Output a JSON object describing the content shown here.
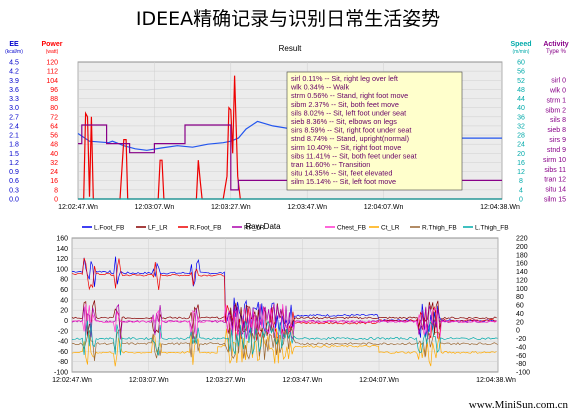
{
  "page": {
    "title": "IDEEA精确记录与识别日常生活姿势",
    "footer": "www.MiniSun.com.cn"
  },
  "chart_data": [
    {
      "type": "line",
      "title": "Result",
      "left_axes": [
        {
          "name": "EE",
          "unit": "(kcal/m)",
          "color": "#0000cc",
          "ticks": [
            "4.5",
            "4.2",
            "3.9",
            "3.6",
            "3.3",
            "3.0",
            "2.7",
            "2.4",
            "2.1",
            "1.8",
            "1.5",
            "1.2",
            "0.9",
            "0.6",
            "0.3",
            "0.0"
          ]
        },
        {
          "name": "Power",
          "unit": "(watt)",
          "color": "#ff0000",
          "ticks": [
            "120",
            "112",
            "104",
            "96",
            "88",
            "80",
            "72",
            "64",
            "56",
            "48",
            "40",
            "32",
            "24",
            "16",
            "8",
            "0"
          ]
        }
      ],
      "right_axes": [
        {
          "name": "Speed",
          "unit": "(m/min)",
          "color": "#00aaaa",
          "ticks": [
            "60",
            "56",
            "52",
            "48",
            "44",
            "40",
            "36",
            "32",
            "28",
            "24",
            "20",
            "16",
            "12",
            "8",
            "4",
            "0"
          ]
        },
        {
          "name": "Activity",
          "unit": "Type %",
          "color": "#880088",
          "ticks": [
            "sirl 0",
            "wlk 0",
            "strm 1",
            "sibm 2",
            "sils 8",
            "sieb 8",
            "sirs 9",
            "stnd 9",
            "sirm 10",
            "sibs 11",
            "tran 12",
            "situ 14",
            "silm 15"
          ]
        }
      ],
      "x_ticks": [
        "12:02:47.Wn",
        "12:03:07.Wn",
        "12:03:27.Wn",
        "12:03:47.Wn",
        "12:04:07.Wn",
        "12:04:38.Wn"
      ],
      "x_seconds": [
        0,
        20,
        40,
        60,
        80,
        111
      ],
      "legend_box": [
        "sirl 0.11% -- Sit, right leg over left",
        "wlk 0.34% -- Walk",
        "strm 0.56% -- Stand, right foot move",
        "sibm 2.37% -- Sit, both feet move",
        "sils 8.02% -- Sit, left foot under seat",
        "sieb 8.36% -- Sit, elbows on legs",
        "sirs 8.59% -- Sit, right foot under seat",
        "stnd 8.74% -- Stand, upright(normal)",
        "sirm 10.40% -- Sit, right foot move",
        "sibs 11.41% -- Sit, both feet under seat",
        "tran 11.60% -- Transition",
        "situ 14.35% -- Sit, feet elevated",
        "silm 15.14% -- Sit, left foot move"
      ],
      "series": [
        {
          "name": "EE",
          "color": "#2255ee",
          "axis": "EE",
          "points": [
            [
              0,
              2.15
            ],
            [
              3,
              1.9
            ],
            [
              8,
              1.85
            ],
            [
              9,
              1.9
            ],
            [
              12,
              1.75
            ],
            [
              15,
              1.65
            ],
            [
              18,
              1.6
            ],
            [
              22,
              1.68
            ],
            [
              26,
              1.75
            ],
            [
              30,
              1.7
            ],
            [
              34,
              1.8
            ],
            [
              38,
              1.85
            ],
            [
              40,
              1.9
            ],
            [
              42,
              2.0
            ],
            [
              44,
              2.3
            ],
            [
              47,
              2.55
            ],
            [
              51,
              2.4
            ],
            [
              56,
              2.3
            ],
            [
              62,
              2.2
            ],
            [
              68,
              2.12
            ],
            [
              76,
              2.05
            ],
            [
              86,
              2.0
            ],
            [
              100,
              2.0
            ],
            [
              111,
              2.0
            ]
          ]
        },
        {
          "name": "Power",
          "color": "#ee0000",
          "axis": "Power",
          "points": [
            [
              0,
              0
            ],
            [
              1.5,
              0
            ],
            [
              2,
              75
            ],
            [
              2.5,
              72
            ],
            [
              3,
              2
            ],
            [
              3.5,
              72
            ],
            [
              4,
              0
            ],
            [
              11,
              0
            ],
            [
              12,
              52
            ],
            [
              12.6,
              52
            ],
            [
              13,
              0
            ],
            [
              21,
              0
            ],
            [
              21.5,
              34
            ],
            [
              22,
              34
            ],
            [
              22.5,
              0
            ],
            [
              31,
              0
            ],
            [
              31.5,
              34
            ],
            [
              32,
              16
            ],
            [
              32.5,
              0
            ],
            [
              38,
              0
            ],
            [
              39,
              20
            ],
            [
              39.5,
              80
            ],
            [
              40,
              78
            ],
            [
              40.5,
              40
            ],
            [
              41,
              108
            ],
            [
              41.8,
              20
            ],
            [
              42.5,
              0
            ],
            [
              111,
              0
            ]
          ]
        },
        {
          "name": "Activity type",
          "color": "#880088",
          "axis": "Activity",
          "points": [
            [
              0,
              1.82
            ],
            [
              1,
              1.82
            ],
            [
              1,
              2.43
            ],
            [
              7.5,
              2.43
            ],
            [
              7.5,
              1.82
            ],
            [
              13.5,
              1.82
            ],
            [
              13.5,
              1.52
            ],
            [
              20,
              1.52
            ],
            [
              20,
              1.82
            ],
            [
              28,
              1.82
            ],
            [
              28,
              2.43
            ],
            [
              40,
              2.43
            ],
            [
              40,
              0.3
            ],
            [
              42,
              0.3
            ],
            [
              42,
              0.61
            ],
            [
              111,
              0.61
            ]
          ]
        },
        {
          "name": "Speed",
          "color": "#00aaaa",
          "axis": "Speed",
          "points": [
            [
              0,
              0
            ],
            [
              111,
              0
            ]
          ]
        }
      ]
    },
    {
      "type": "line",
      "title": "Raw Data",
      "legend": [
        {
          "name": "L.Foot_FB",
          "color": "#0000ee"
        },
        {
          "name": "LF_LR",
          "color": "#880000"
        },
        {
          "name": "R.Foot_FB",
          "color": "#ee0000"
        },
        {
          "name": "RF_LR",
          "color": "#aa00aa"
        },
        {
          "name": "Chest_FB",
          "color": "#ff33cc"
        },
        {
          "name": "Ct_LR",
          "color": "#ffaa00"
        },
        {
          "name": "R.Thigh_FB",
          "color": "#996633"
        },
        {
          "name": "L.Thigh_FB",
          "color": "#00aaaa"
        }
      ],
      "y_ticks_left": [
        "160",
        "140",
        "120",
        "100",
        "80",
        "60",
        "40",
        "20",
        "0",
        "-20",
        "-40",
        "-60",
        "-80",
        "-100"
      ],
      "y_ticks_right": [
        "220",
        "200",
        "180",
        "160",
        "140",
        "120",
        "100",
        "80",
        "60",
        "40",
        "20",
        "0",
        "-20",
        "-40",
        "-60",
        "-80",
        "-100"
      ],
      "x_ticks": [
        "12:02:47.Wn",
        "12:03:07.Wn",
        "12:03:27.Wn",
        "12:03:47.Wn",
        "12:04:07.Wn",
        "12:04:38.Wn"
      ],
      "x_seconds": [
        0,
        20,
        40,
        60,
        80,
        111
      ],
      "ylim_left": [
        -100,
        160
      ],
      "series_levels": [
        {
          "name": "L.Foot_FB",
          "segments": [
            [
              0,
              10,
              95
            ],
            [
              10,
              40,
              92
            ],
            [
              40,
              80,
              10
            ],
            [
              80,
              111,
              0
            ]
          ]
        },
        {
          "name": "R.Foot_FB",
          "segments": [
            [
              0,
              10,
              90
            ],
            [
              10,
              40,
              88
            ],
            [
              40,
              80,
              -5
            ],
            [
              80,
              111,
              0
            ]
          ]
        },
        {
          "name": "LF_LR",
          "segments": [
            [
              0,
              40,
              5
            ],
            [
              40,
              111,
              5
            ]
          ]
        },
        {
          "name": "RF_LR",
          "segments": [
            [
              0,
              40,
              -2
            ],
            [
              40,
              111,
              -2
            ]
          ]
        },
        {
          "name": "Chest_FB",
          "segments": [
            [
              0,
              111,
              -2
            ]
          ]
        },
        {
          "name": "Ct_LR",
          "segments": [
            [
              0,
              38,
              -62
            ],
            [
              38,
              80,
              -50
            ],
            [
              80,
              111,
              -62
            ]
          ]
        },
        {
          "name": "R.Thigh_FB",
          "segments": [
            [
              0,
              38,
              -45
            ],
            [
              38,
              111,
              -45
            ]
          ]
        },
        {
          "name": "L.Thigh_FB",
          "segments": [
            [
              0,
              38,
              -35
            ],
            [
              38,
              111,
              -35
            ]
          ]
        }
      ]
    }
  ]
}
